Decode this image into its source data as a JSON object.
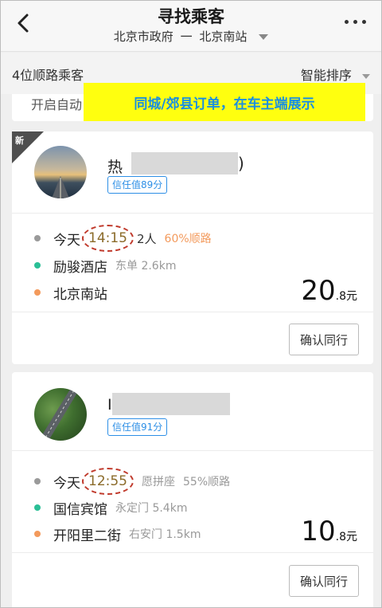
{
  "header": {
    "title": "寻找乘客",
    "route_from": "北京市政府",
    "route_separator": "一",
    "route_to": "北京南站",
    "more_label": "…"
  },
  "subbar": {
    "count": "4位顺路乘客",
    "sort": "智能排序"
  },
  "partial_card_text": "开启自动",
  "banner": "同城/郊县订单，在车主端展示",
  "new_tag": "新",
  "cards": [
    {
      "name_prefix": "热",
      "name_suffix": ")",
      "trust": "信任值89分",
      "today": "今天",
      "time": "14:15",
      "people": "2人",
      "match": "60%顺路",
      "pickup": "励骏酒店",
      "pickup_meta": "东单 2.6km",
      "dropoff": "北京南站",
      "dropoff_meta": "",
      "price_int": "20",
      "price_dec": ".8元",
      "confirm": "确认同行"
    },
    {
      "name_prefix": "I",
      "name_suffix": "",
      "trust": "信任值91分",
      "today": "今天",
      "time": "12:55",
      "people": "愿拼座",
      "match": "55%顺路",
      "pickup": "国信宾馆",
      "pickup_meta": "永定门 5.4km",
      "dropoff": "开阳里二街",
      "dropoff_meta": "右安门 1.5km",
      "price_int": "10",
      "price_dec": ".8元",
      "confirm": "确认同行"
    }
  ],
  "colors": {
    "banner_bg": "#ffff0f",
    "banner_text": "#1a8fe0",
    "trust_blue": "#2e8fe6",
    "match_orange": "#f39a5c",
    "pickup_green": "#2bbf96",
    "time_circle": "#c0392b"
  }
}
